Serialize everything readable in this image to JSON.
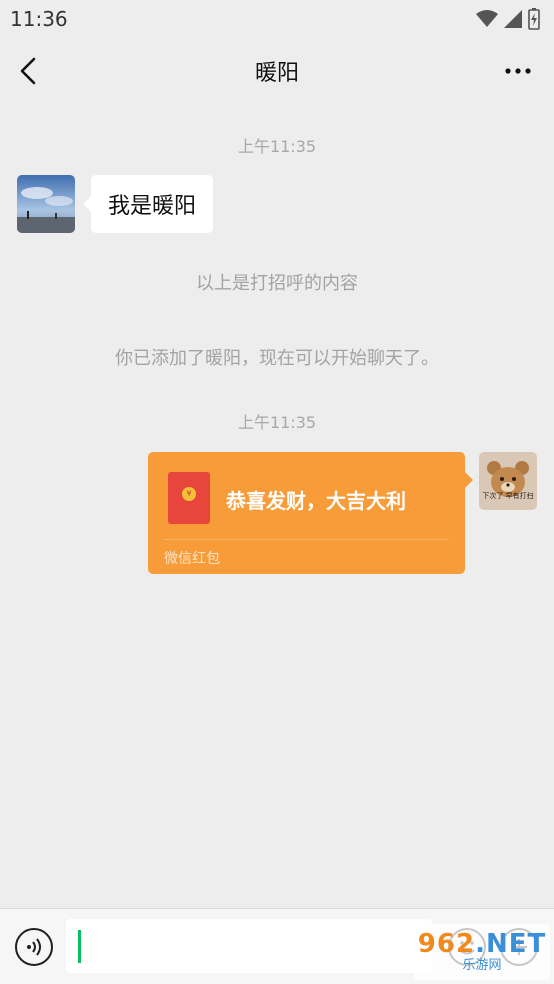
{
  "status_bar": {
    "time": "11:36"
  },
  "header": {
    "title": "暖阳"
  },
  "messages": {
    "time_1": "上午11:35",
    "incoming_text": "我是暖阳",
    "sys_1": "以上是打招呼的内容",
    "sys_2": "你已添加了暖阳，现在可以开始聊天了。",
    "time_2": "上午11:35",
    "red_packet": {
      "title": "恭喜发财，大吉大利",
      "caption": "微信红包",
      "coin": "¥"
    },
    "sticker_caption": "下次了 早有打扫"
  },
  "input_bar": {
    "value": "",
    "placeholder": ""
  },
  "watermark": {
    "top_a": "962",
    "top_b": ".NET",
    "bottom": "乐游网"
  },
  "colors": {
    "background": "#ededed",
    "red_packet": "#f79c39",
    "caret": "#07c160"
  }
}
